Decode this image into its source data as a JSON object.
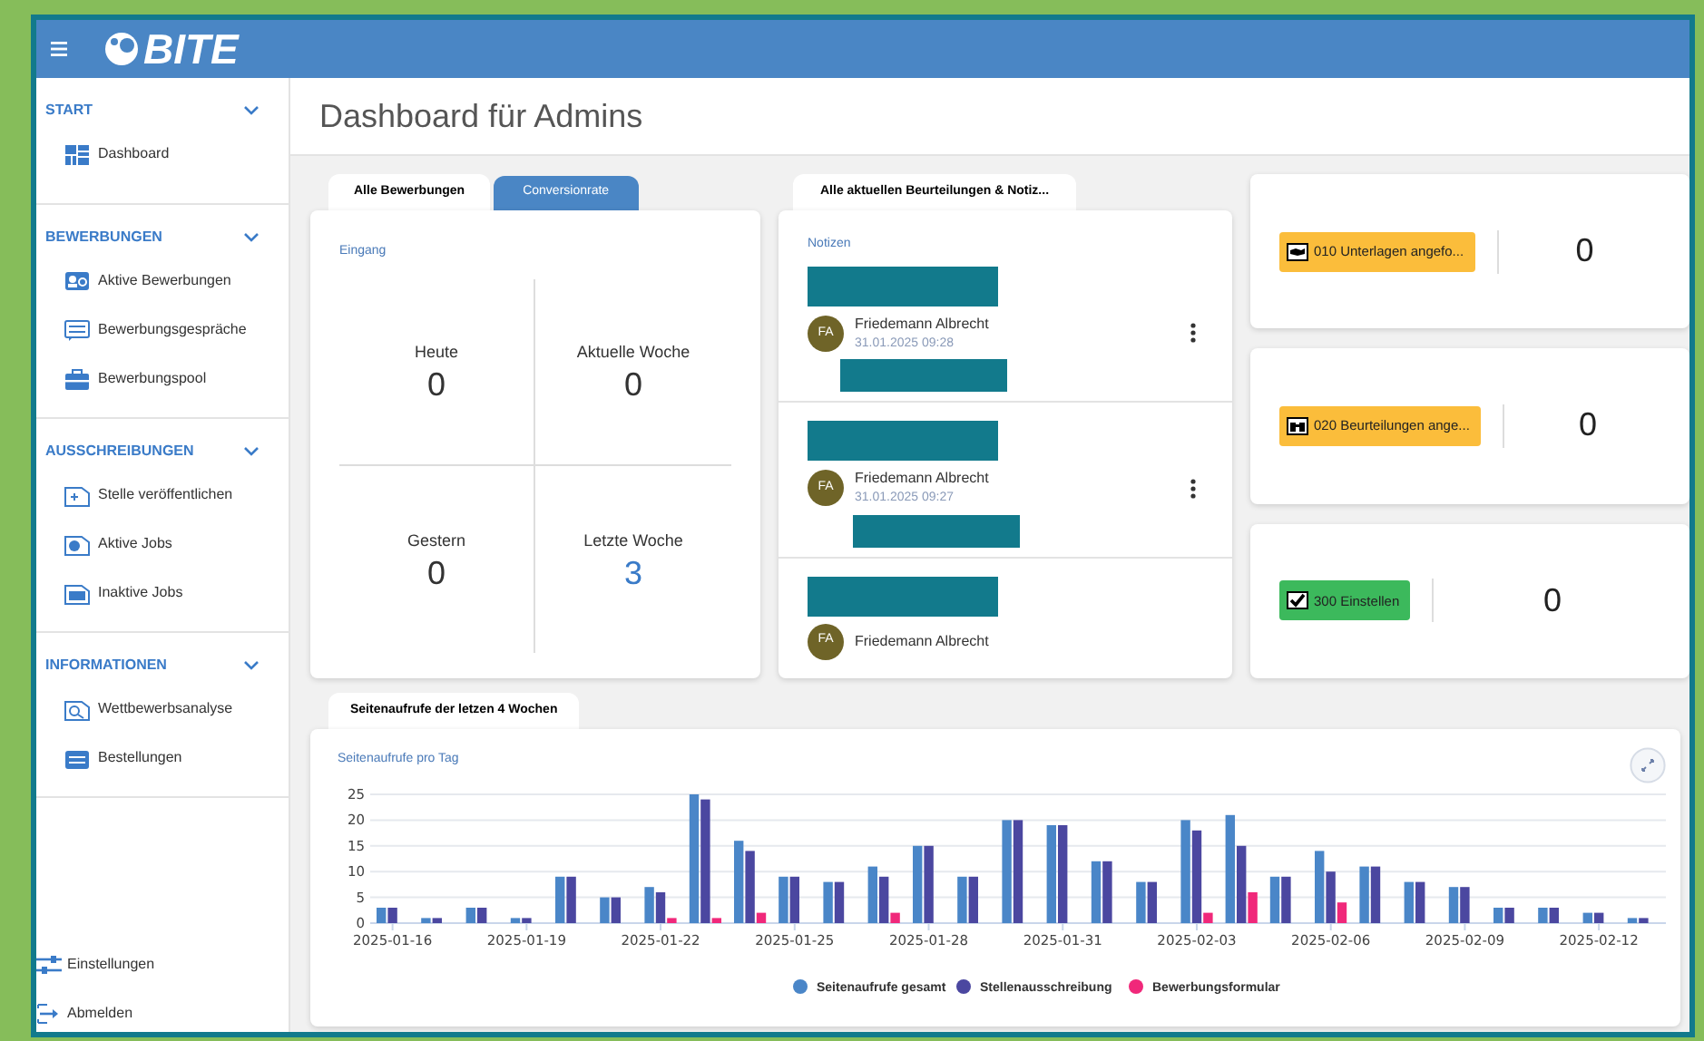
{
  "top_bar": {
    "logo": "BITE"
  },
  "sidebar": {
    "sections": [
      {
        "title": "START",
        "expanded": true,
        "items": [
          {
            "label": "Dashboard"
          }
        ]
      },
      {
        "title": "BEWERBUNGEN",
        "expanded": true,
        "items": [
          {
            "label": "Aktive Bewerbungen"
          },
          {
            "label": "Bewerbungsgespräche"
          },
          {
            "label": "Bewerbungspool"
          }
        ]
      },
      {
        "title": "AUSSCHREIBUNGEN",
        "expanded": true,
        "items": [
          {
            "label": "Stelle veröffentlichen"
          },
          {
            "label": "Aktive Jobs"
          },
          {
            "label": "Inaktive Jobs"
          }
        ]
      },
      {
        "title": "INFORMATIONEN",
        "expanded": true,
        "items": [
          {
            "label": "Wettbewerbsanalyse"
          },
          {
            "label": "Bestellungen"
          }
        ]
      }
    ],
    "footer_items": [
      {
        "label": "Einstellungen"
      },
      {
        "label": "Abmelden"
      }
    ]
  },
  "page_title": "Dashboard für Admins",
  "applications_card": {
    "tabs": [
      {
        "label": "Alle Bewerbungen",
        "selected": true
      },
      {
        "label": "Conversionrate",
        "selected": false
      }
    ],
    "section_label": "Eingang",
    "stats": [
      {
        "label": "Heute",
        "value": "0",
        "link": false
      },
      {
        "label": "Aktuelle Woche",
        "value": "0",
        "link": false
      },
      {
        "label": "Gestern",
        "value": "0",
        "link": false
      },
      {
        "label": "Letzte Woche",
        "value": "3",
        "link": true
      }
    ]
  },
  "notes_card": {
    "tab": "Alle aktuellen Beurteilungen & Notiz...",
    "section_label": "Notizen",
    "notes": [
      {
        "initials": "FA",
        "author": "Friedemann Albrecht",
        "timestamp": "31.01.2025 09:28",
        "menu": true,
        "redacted_text": true
      },
      {
        "initials": "FA",
        "author": "Friedemann Albrecht",
        "timestamp": "31.01.2025 09:27",
        "menu": true,
        "redacted_text": true
      },
      {
        "initials": "FA",
        "author": "Friedemann Albrecht",
        "menu": false,
        "redacted_text": false
      }
    ]
  },
  "status_cards": [
    {
      "label": "010 Unterlagen angefo...",
      "count": "0",
      "color": "#fbbd3b"
    },
    {
      "label": "020 Beurteilungen ange...",
      "count": "0",
      "color": "#fbbd3b"
    },
    {
      "label": "300 Einstellen",
      "count": "0",
      "color": "#3cb95c"
    }
  ],
  "chart_panel": {
    "tab": "Seitenaufrufe der letzen 4 Wochen",
    "subtitle": "Seitenaufrufe pro Tag",
    "chart_data": {
      "type": "bar",
      "categories": [
        "2025-01-16",
        null,
        null,
        "2025-01-19",
        null,
        null,
        "2025-01-22",
        null,
        null,
        "2025-01-25",
        null,
        null,
        "2025-01-28",
        null,
        null,
        "2025-01-31",
        null,
        null,
        "2025-02-03",
        null,
        null,
        "2025-02-06",
        null,
        null,
        "2025-02-09",
        null,
        null,
        "2025-02-12",
        null
      ],
      "series": [
        {
          "name": "Seitenaufrufe gesamt",
          "color": "#4a86c8",
          "values": [
            3,
            1,
            3,
            1,
            9,
            5,
            7,
            25,
            16,
            9,
            8,
            11,
            15,
            9,
            20,
            19,
            12,
            8,
            20,
            21,
            9,
            14,
            11,
            8,
            7,
            3,
            3,
            2,
            1
          ]
        },
        {
          "name": "Stellenausschreibung",
          "color": "#4b47a0",
          "values": [
            3,
            1,
            3,
            1,
            9,
            5,
            6,
            24,
            14,
            9,
            8,
            9,
            15,
            9,
            20,
            19,
            12,
            8,
            18,
            15,
            9,
            10,
            11,
            8,
            7,
            3,
            3,
            2,
            1
          ]
        },
        {
          "name": "Bewerbungsformular",
          "color": "#f0287a",
          "values": [
            0,
            0,
            0,
            0,
            0,
            0,
            1,
            1,
            2,
            0,
            0,
            2,
            0,
            0,
            0,
            0,
            0,
            0,
            2,
            6,
            0,
            4,
            0,
            0,
            0,
            0,
            0,
            0,
            0
          ]
        }
      ],
      "ylim": [
        0,
        25
      ],
      "yticks": [
        0,
        5,
        10,
        15,
        20,
        25
      ],
      "grid": true,
      "legend": true
    }
  }
}
